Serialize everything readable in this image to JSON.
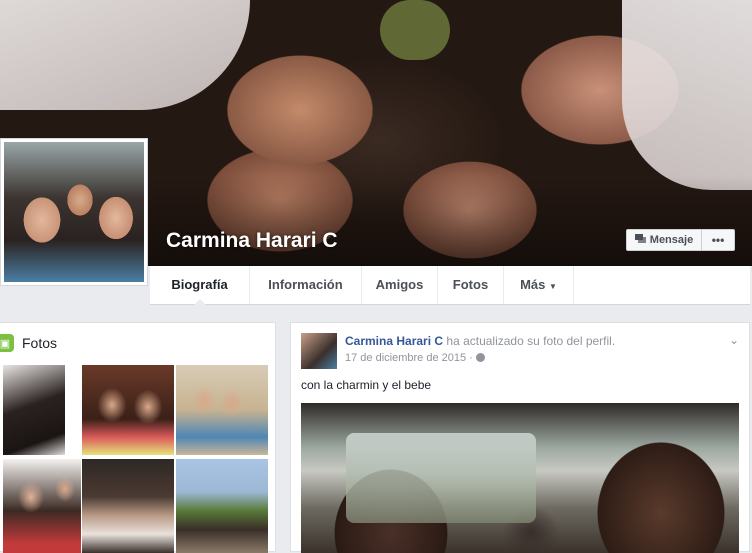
{
  "profile": {
    "name": "Carmina Harari C",
    "message_button": "Mensaje",
    "more_button": "•••"
  },
  "nav": {
    "tabs": [
      {
        "label": "Biografía",
        "active": true
      },
      {
        "label": "Información",
        "active": false
      },
      {
        "label": "Amigos",
        "active": false
      },
      {
        "label": "Fotos",
        "active": false
      },
      {
        "label": "Más",
        "active": false
      }
    ]
  },
  "photos_card": {
    "title": "Fotos"
  },
  "post": {
    "author": "Carmina Harari C",
    "action": "ha actualizado su foto del perfil.",
    "date": "17 de diciembre de 2015 ·",
    "text": "con la charmin y el bebe"
  },
  "colors": {
    "accent": "#365899",
    "page_bg": "#e9ebee",
    "photos_icon": "#7bc043"
  }
}
